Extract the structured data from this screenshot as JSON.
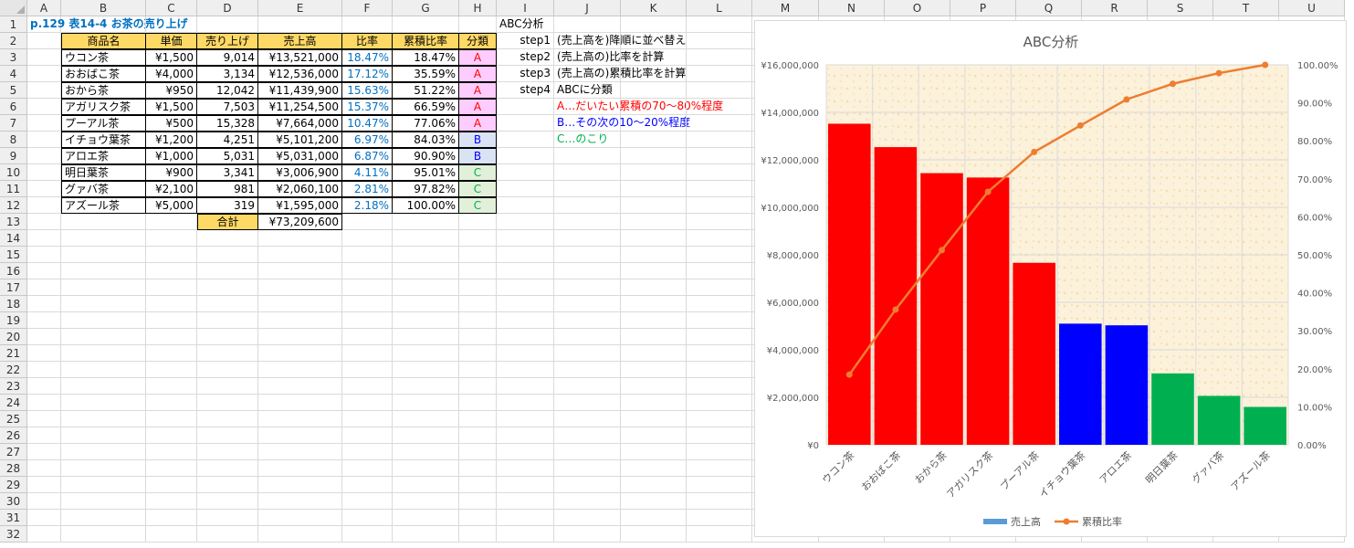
{
  "columns": [
    "A",
    "B",
    "C",
    "D",
    "E",
    "F",
    "G",
    "H",
    "I",
    "J",
    "K",
    "L",
    "M",
    "N",
    "O",
    "P",
    "Q",
    "R",
    "S",
    "T",
    "U"
  ],
  "rows": [
    "1",
    "2",
    "3",
    "4",
    "5",
    "6",
    "7",
    "8",
    "9",
    "10",
    "11",
    "12",
    "13",
    "14",
    "15",
    "16",
    "17",
    "18",
    "19",
    "20",
    "21",
    "22",
    "23",
    "24",
    "25",
    "26",
    "27",
    "28",
    "29",
    "30",
    "31",
    "32"
  ],
  "sheet_title": "p.129 表14-4 お茶の売り上げ",
  "table": {
    "headers": [
      "商品名",
      "単価",
      "売り上げ",
      "売上高",
      "比率",
      "累積比率",
      "分類"
    ],
    "rows": [
      [
        "ウコン茶",
        "¥1,500",
        "9,014",
        "¥13,521,000",
        "18.47%",
        "18.47%",
        "A"
      ],
      [
        "おおばこ茶",
        "¥4,000",
        "3,134",
        "¥12,536,000",
        "17.12%",
        "35.59%",
        "A"
      ],
      [
        "おから茶",
        "¥950",
        "12,042",
        "¥11,439,900",
        "15.63%",
        "51.22%",
        "A"
      ],
      [
        "アガリスク茶",
        "¥1,500",
        "7,503",
        "¥11,254,500",
        "15.37%",
        "66.59%",
        "A"
      ],
      [
        "プーアル茶",
        "¥500",
        "15,328",
        "¥7,664,000",
        "10.47%",
        "77.06%",
        "A"
      ],
      [
        "イチョウ葉茶",
        "¥1,200",
        "4,251",
        "¥5,101,200",
        "6.97%",
        "84.03%",
        "B"
      ],
      [
        "アロエ茶",
        "¥1,000",
        "5,031",
        "¥5,031,000",
        "6.87%",
        "90.90%",
        "B"
      ],
      [
        "明日葉茶",
        "¥900",
        "3,341",
        "¥3,006,900",
        "4.11%",
        "95.01%",
        "C"
      ],
      [
        "グァバ茶",
        "¥2,100",
        "981",
        "¥2,060,100",
        "2.81%",
        "97.82%",
        "C"
      ],
      [
        "アズール茶",
        "¥5,000",
        "319",
        "¥1,595,000",
        "2.18%",
        "100.00%",
        "C"
      ]
    ],
    "total_label": "合計",
    "total_value": "¥73,209,600"
  },
  "notes": {
    "heading": "ABC分析",
    "steps": [
      {
        "step": "step1",
        "text": "(売上高を)降順に並べ替え"
      },
      {
        "step": "step2",
        "text": "(売上高の)比率を計算"
      },
      {
        "step": "step3",
        "text": "(売上高の)累積比率を計算"
      },
      {
        "step": "step4",
        "text": "ABCに分類"
      }
    ],
    "classA": "A…だいたい累積の70〜80%程度",
    "classB": "B…その次の10〜20%程度",
    "classC": "C…のこり"
  },
  "colors": {
    "A": "#ff0000",
    "B": "#0000ff",
    "C": "#00b050",
    "line": "#ed7d31",
    "legend_bar": "#5b9bd5",
    "plot_bg": "#fcf1da"
  },
  "chart_data": {
    "type": "bar",
    "title": "ABC分析",
    "categories": [
      "ウコン茶",
      "おおばこ茶",
      "おから茶",
      "アガリスク茶",
      "プーアル茶",
      "イチョウ葉茶",
      "アロエ茶",
      "明日葉茶",
      "グァバ茶",
      "アズール茶"
    ],
    "series": [
      {
        "name": "売上高",
        "type": "bar",
        "axis": "left",
        "values": [
          13521000,
          12536000,
          11439900,
          11254500,
          7664000,
          5101200,
          5031000,
          3006900,
          2060100,
          1595000
        ],
        "classes": [
          "A",
          "A",
          "A",
          "A",
          "A",
          "B",
          "B",
          "C",
          "C",
          "C"
        ]
      },
      {
        "name": "累積比率",
        "type": "line",
        "axis": "right",
        "values": [
          18.47,
          35.59,
          51.22,
          66.59,
          77.06,
          84.03,
          90.9,
          95.01,
          97.82,
          100.0
        ]
      }
    ],
    "ylim": [
      0,
      16000000
    ],
    "y_ticks": [
      "¥0",
      "¥2,000,000",
      "¥4,000,000",
      "¥6,000,000",
      "¥8,000,000",
      "¥10,000,000",
      "¥12,000,000",
      "¥14,000,000",
      "¥16,000,000"
    ],
    "y2lim": [
      0,
      100
    ],
    "y2_ticks": [
      "0.00%",
      "10.00%",
      "20.00%",
      "30.00%",
      "40.00%",
      "50.00%",
      "60.00%",
      "70.00%",
      "80.00%",
      "90.00%",
      "100.00%"
    ],
    "grid": true,
    "legend": "bottom"
  }
}
